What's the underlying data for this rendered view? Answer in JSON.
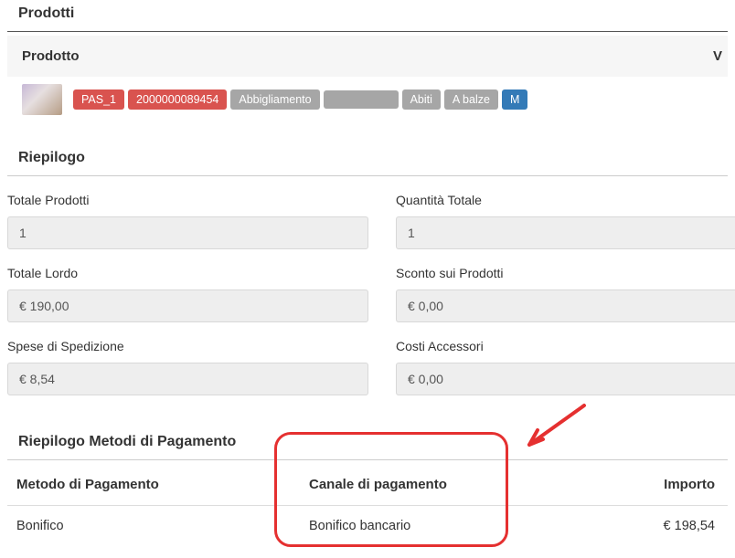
{
  "sections": {
    "prodotti_title": "Prodotti",
    "prodotto_header": "Prodotto",
    "vendor_header_cut": "V",
    "riepilogo_title": "Riepilogo",
    "metodi_title": "Riepilogo Metodi di Pagamento"
  },
  "tags": {
    "t0": "PAS_1",
    "t1": "2000000089454",
    "t2": "Abbigliamento",
    "t3": "",
    "t4": "Abiti",
    "t5": "A balze",
    "t6": "M"
  },
  "summary": {
    "totale_prodotti_label": "Totale Prodotti",
    "totale_prodotti_value": "1",
    "quantita_totale_label": "Quantità Totale",
    "quantita_totale_value": "1",
    "totale_lordo_label": "Totale Lordo",
    "totale_lordo_value": "€ 190,00",
    "sconto_prodotti_label": "Sconto sui Prodotti",
    "sconto_prodotti_value": "€ 0,00",
    "spese_spedizione_label": "Spese di Spedizione",
    "spese_spedizione_value": "€ 8,54",
    "costi_accessori_label": "Costi Accessori",
    "costi_accessori_value": "€ 0,00"
  },
  "payment": {
    "col_metodo": "Metodo di Pagamento",
    "col_canale": "Canale di pagamento",
    "col_importo": "Importo",
    "row_metodo": "Bonifico",
    "row_canale": "Bonifico bancario",
    "row_importo": "€ 198,54"
  }
}
